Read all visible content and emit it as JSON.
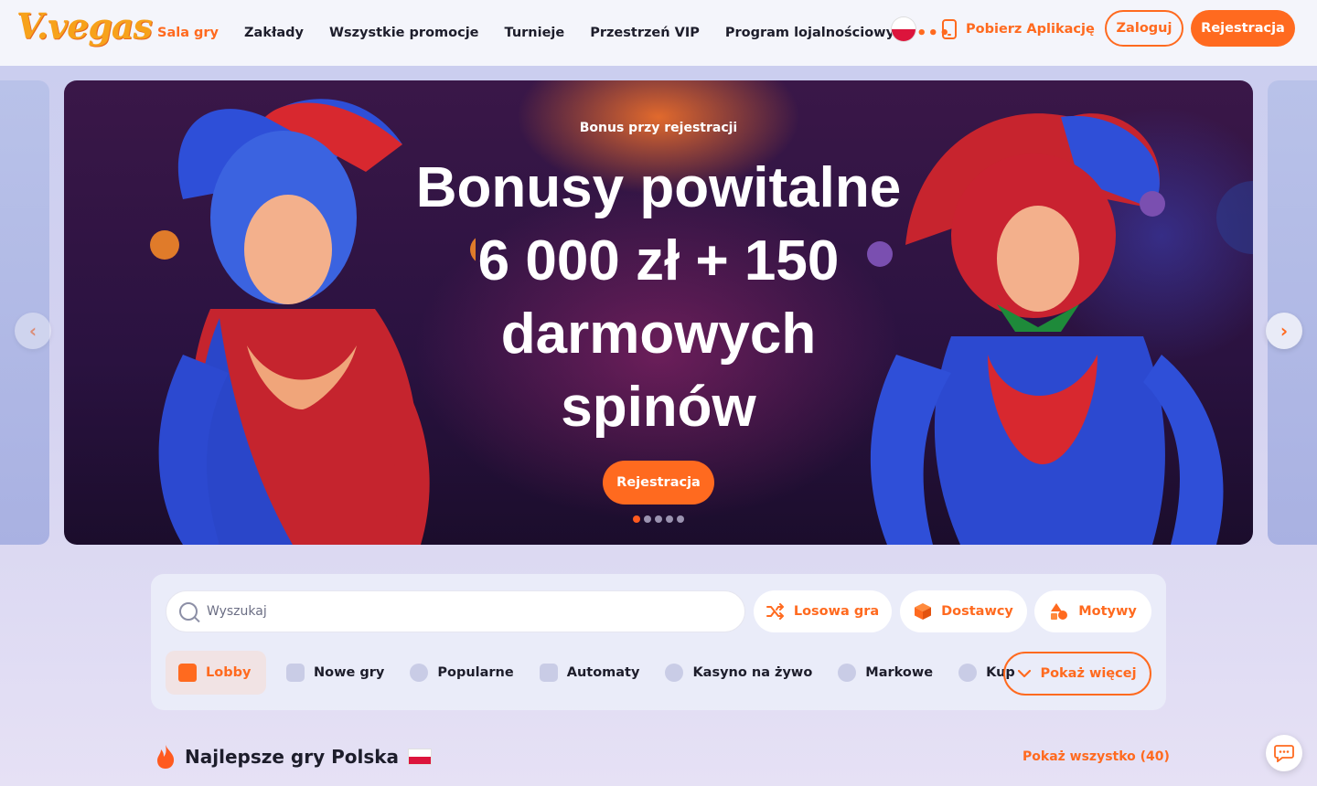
{
  "header": {
    "logo": "V.vegas",
    "nav": [
      {
        "label": "Sala gry",
        "active": true
      },
      {
        "label": "Zakłady"
      },
      {
        "label": "Wszystkie promocje"
      },
      {
        "label": "Turnieje"
      },
      {
        "label": "Przestrzeń VIP"
      },
      {
        "label": "Program lojalnościowy"
      }
    ],
    "more_icon": "•••",
    "app_link": "Pobierz Aplikację",
    "login": "Zaloguj",
    "register": "Rejestracja"
  },
  "banner": {
    "subtitle": "Bonus przy rejestracji",
    "title_lines": [
      "Bonusy powitalne",
      "6 000 zł + 150",
      "darmowych",
      "spinów"
    ],
    "cta": "Rejestracja",
    "slides_count": 5,
    "active_slide": 1
  },
  "search": {
    "placeholder": "Wyszukaj",
    "random_game": "Losowa gra",
    "providers": "Dostawcy",
    "themes": "Motywy"
  },
  "categories": [
    {
      "label": "Lobby",
      "icon": "home-icon",
      "active": true
    },
    {
      "label": "Nowe gry",
      "icon": "new-icon"
    },
    {
      "label": "Popularne",
      "icon": "heart-icon"
    },
    {
      "label": "Automaty",
      "icon": "slot-icon"
    },
    {
      "label": "Kasyno na żywo",
      "icon": "live-icon"
    },
    {
      "label": "Markowe",
      "icon": "palette-icon"
    },
    {
      "label": "Kup",
      "icon": "coin-icon"
    }
  ],
  "show_more": "Pokaż więcej",
  "section": {
    "title": "Najlepsze gry Polska",
    "show_all": "Pokaż wszystko (40)"
  },
  "colors": {
    "accent": "#ff6a1f",
    "header_bg": "#f4f5fb",
    "text": "#1d1d2b"
  }
}
